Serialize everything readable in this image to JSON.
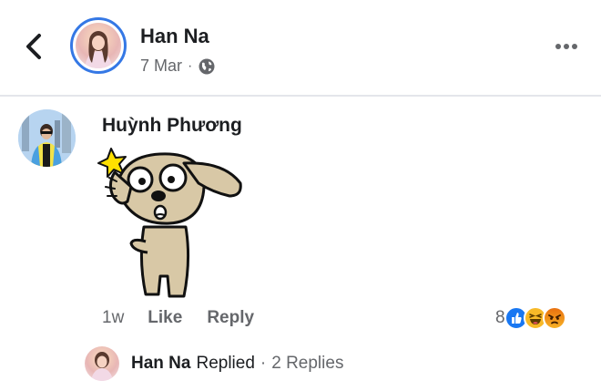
{
  "header": {
    "name": "Han Na",
    "date": "7 Mar",
    "separator": "·",
    "privacy_icon": "globe-icon",
    "back_icon": "chevron-left-icon",
    "more_icon": "more-horizontal-icon"
  },
  "comment": {
    "author": "Huỳnh Phương",
    "sticker": "surprised-dog-sticker",
    "time": "1w",
    "like_label": "Like",
    "reply_label": "Reply",
    "reaction_count": "8",
    "reactions": [
      "like",
      "haha",
      "angry"
    ]
  },
  "reply_summary": {
    "name": "Han Na",
    "verb": "Replied",
    "separator": "·",
    "count_label": "2 Replies"
  },
  "colors": {
    "accent": "#3578e5",
    "text_secondary": "#65676b",
    "like_blue": "#1877f2",
    "haha_yellow": "#f7b928",
    "angry_orange": "#e9710f"
  }
}
